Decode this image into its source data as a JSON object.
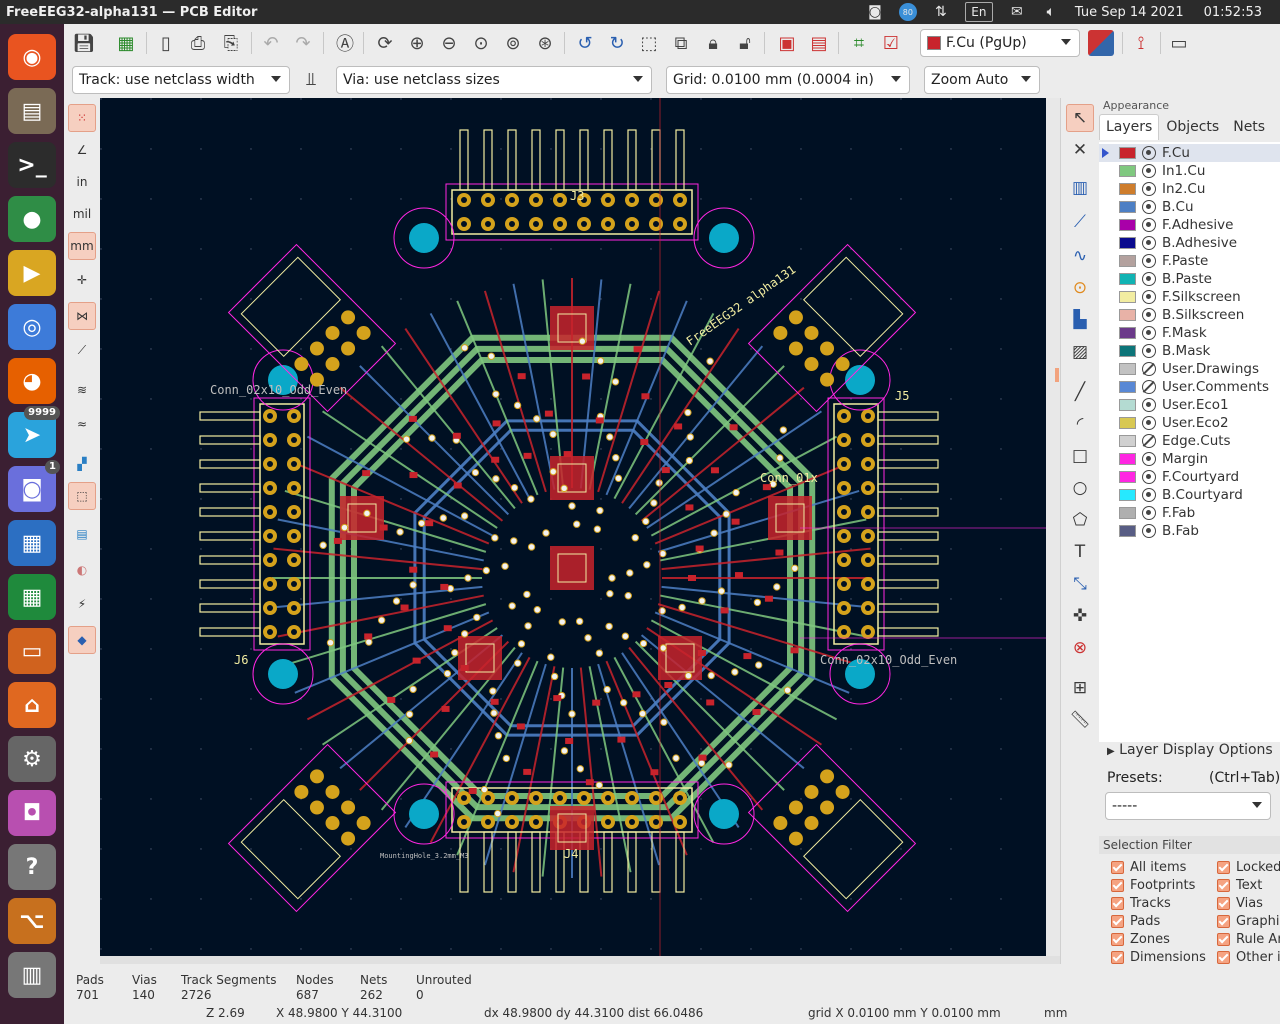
{
  "window": {
    "title": "FreeEEG32-alpha131 — PCB Editor"
  },
  "tray": {
    "badge_value": "80",
    "lang": "En",
    "datetime": "Tue Sep 14 2021",
    "time": "01:52:53"
  },
  "dock": {
    "apps": [
      {
        "name": "ubuntu-logo-icon",
        "glyph": "◉",
        "color": "#e95420"
      },
      {
        "name": "files-icon",
        "glyph": "▤",
        "color": "#7a6a55"
      },
      {
        "name": "terminal-icon",
        "glyph": ">_",
        "color": "#2c2c2c"
      },
      {
        "name": "chrome-icon",
        "glyph": "●",
        "color": "#2f8d46"
      },
      {
        "name": "kicad-icon",
        "glyph": "▶",
        "color": "#d9a622"
      },
      {
        "name": "chromium-icon",
        "glyph": "◎",
        "color": "#3d7bd9"
      },
      {
        "name": "firefox-icon",
        "glyph": "◕",
        "color": "#e66000"
      },
      {
        "name": "telegram-icon",
        "glyph": "➤",
        "color": "#2aa3dc",
        "badge": "9999"
      },
      {
        "name": "discord-icon",
        "glyph": "◙",
        "color": "#6a6fdc",
        "badge": "1"
      },
      {
        "name": "writer-icon",
        "glyph": "▦",
        "color": "#2c6fc2"
      },
      {
        "name": "calc-icon",
        "glyph": "▦",
        "color": "#1f8a3c"
      },
      {
        "name": "impress-icon",
        "glyph": "▭",
        "color": "#d0621e"
      },
      {
        "name": "software-icon",
        "glyph": "⌂",
        "color": "#e06820"
      },
      {
        "name": "settings-icon",
        "glyph": "⚙",
        "color": "#666"
      },
      {
        "name": "shotwell-icon",
        "glyph": "◘",
        "color": "#b84fb0"
      },
      {
        "name": "help-icon",
        "glyph": "?",
        "color": "#777"
      },
      {
        "name": "pcb-calc-icon",
        "glyph": "⌥",
        "color": "#c7701e"
      },
      {
        "name": "bitmap2component-icon",
        "glyph": "▥",
        "color": "#777"
      }
    ]
  },
  "toolbar": {
    "track_width": "Track: use netclass width",
    "via_size": "Via: use netclass sizes",
    "grid": "Grid: 0.0100 mm (0.0004 in)",
    "zoom": "Zoom Auto",
    "active_layer": "F.Cu (PgUp)",
    "layer_color": "#c8232c"
  },
  "board": {
    "ref_labels": [
      "J3",
      "J4",
      "J5",
      "J6"
    ],
    "conn_label": "Conn_02x10_Odd_Even",
    "conn_short": "Conn_01x",
    "board_text": "FreeEEG32 alpha131",
    "mounting_hole": "MountingHole_3.2mm_M3",
    "track_colors": {
      "front": "#c8232c",
      "back": "#4d7fc4",
      "inner1": "#7fc87f",
      "pads": "#d4a21c",
      "courtyard": "#ff26e2",
      "edge": "#d0d0d0",
      "silk": "#f2eda1",
      "holes": "#0aa8c8"
    }
  },
  "appearance": {
    "title": "Appearance",
    "tabs": [
      "Layers",
      "Objects",
      "Nets"
    ],
    "active_tab": "Layers",
    "layers": [
      {
        "name": "F.Cu",
        "color": "#c8232c",
        "visible": true,
        "selected": true
      },
      {
        "name": "In1.Cu",
        "color": "#7fc87f",
        "visible": true
      },
      {
        "name": "In2.Cu",
        "color": "#ce7d2c",
        "visible": true
      },
      {
        "name": "B.Cu",
        "color": "#4d7fc4",
        "visible": true
      },
      {
        "name": "F.Adhesive",
        "color": "#a900a9",
        "visible": true
      },
      {
        "name": "B.Adhesive",
        "color": "#0a0a8e",
        "visible": true
      },
      {
        "name": "F.Paste",
        "color": "#b3a19e",
        "visible": true
      },
      {
        "name": "B.Paste",
        "color": "#11b3b3",
        "visible": true
      },
      {
        "name": "F.Silkscreen",
        "color": "#f2eda1",
        "visible": true
      },
      {
        "name": "B.Silkscreen",
        "color": "#e8b2a7",
        "visible": true
      },
      {
        "name": "F.Mask",
        "color": "#6b3a8a",
        "visible": true
      },
      {
        "name": "B.Mask",
        "color": "#0d7579",
        "visible": true
      },
      {
        "name": "User.Drawings",
        "color": "#c2c2c2",
        "visible": false
      },
      {
        "name": "User.Comments",
        "color": "#5988d5",
        "visible": false
      },
      {
        "name": "User.Eco1",
        "color": "#b4dbd2",
        "visible": true
      },
      {
        "name": "User.Eco2",
        "color": "#d8c852",
        "visible": true
      },
      {
        "name": "Edge.Cuts",
        "color": "#d0d0d0",
        "visible": false
      },
      {
        "name": "Margin",
        "color": "#ff26e2",
        "visible": true
      },
      {
        "name": "F.Courtyard",
        "color": "#ff26e2",
        "visible": true
      },
      {
        "name": "B.Courtyard",
        "color": "#26e9ff",
        "visible": true
      },
      {
        "name": "F.Fab",
        "color": "#afafaf",
        "visible": true
      },
      {
        "name": "B.Fab",
        "color": "#585d84",
        "visible": true
      }
    ],
    "layer_display_options": "Layer Display Options",
    "presets_label": "Presets:",
    "presets_hint": "(Ctrl+Tab)",
    "presets_value": "-----",
    "selection_filter_title": "Selection Filter",
    "selection_filter": {
      "left": [
        "All items",
        "Footprints",
        "Tracks",
        "Pads",
        "Zones",
        "Dimensions"
      ],
      "right": [
        "Locked",
        "Text",
        "Vias",
        "Graphics",
        "Rule Areas",
        "Other items"
      ]
    }
  },
  "status": {
    "headers": [
      "Pads",
      "Vias",
      "Track Segments",
      "Nodes",
      "Nets",
      "Unrouted"
    ],
    "values": [
      "701",
      "140",
      "2726",
      "687",
      "262",
      "0"
    ],
    "zoom": "Z 2.69",
    "cursor": "X 48.9800  Y 44.3100",
    "delta": "dx 48.9800  dy 44.3100  dist 66.0486",
    "grid": "grid X 0.0100 mm  Y 0.0100 mm",
    "units": "mm"
  }
}
